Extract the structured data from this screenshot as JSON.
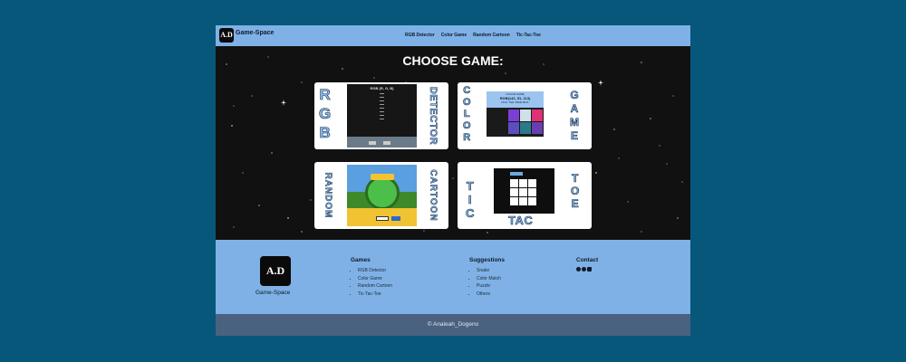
{
  "navbar": {
    "logo_text": "A.D",
    "brand": "Game-Space",
    "links": [
      "RGB Detector",
      "Color Game",
      "Random Cartoon",
      "Tic-Tac-Toe"
    ]
  },
  "main": {
    "title": "CHOOSE GAME:",
    "cards": {
      "rgb": {
        "left_word": "RGB",
        "right_word": "DETECTOR",
        "screen_title": "RGB (R, G, B)"
      },
      "color": {
        "left_word": "COLOR",
        "right_word": "GAME",
        "screen_top": "COLOR GAME",
        "screen_rgb": "RGB(142, 51, 113)",
        "screen_hint": "PICK THE TRUE BOX"
      },
      "cartoon": {
        "left_word": "RANDOM",
        "right_word": "CARTOON"
      },
      "tictactoe": {
        "left_word": "TIC",
        "right_word": "TOE",
        "bottom_word": "TAC"
      }
    }
  },
  "footer": {
    "logo_text": "A.D",
    "brand": "Game-Space",
    "games": {
      "heading": "Games",
      "items": [
        "RGB Detector",
        "Color Game",
        "Random Cartoon",
        "Tic-Tac-Toe"
      ]
    },
    "suggestions": {
      "heading": "Suggestions",
      "items": [
        "Snake",
        "Color Match",
        "Puzzle",
        "Others"
      ]
    },
    "contact": {
      "heading": "Contact",
      "icons": [
        "facebook-icon",
        "messenger-icon",
        "linkedin-icon"
      ]
    }
  },
  "copyright": "© Analeah_Dogeno",
  "colors": {
    "outer_bg": "#07577a",
    "nav_bg": "#7fb1e6",
    "main_bg": "#111111",
    "copyright_bg": "#4a6280",
    "letter_fill": "#8fbef0"
  }
}
